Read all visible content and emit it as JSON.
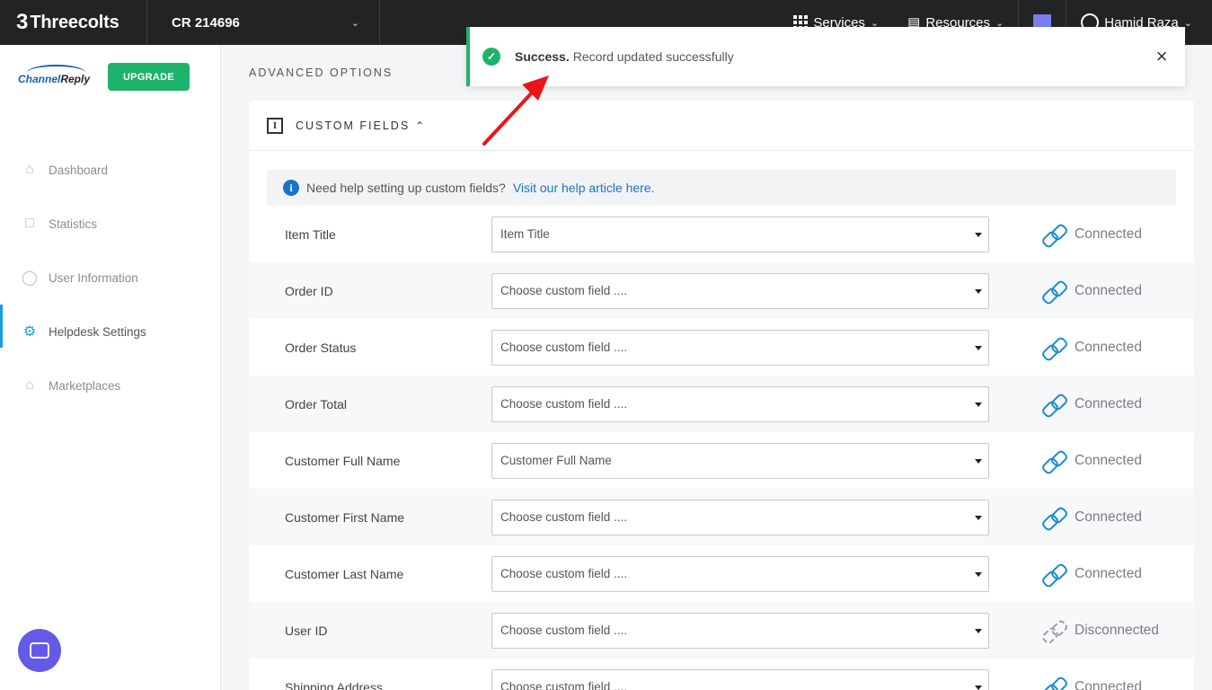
{
  "topbar": {
    "brand_mark": "3",
    "brand_name": "Threecolts",
    "account": "CR 214696",
    "services": "Services",
    "resources": "Resources",
    "user": "Hamid Raza"
  },
  "sidebar": {
    "logo_text_a": "Channel",
    "logo_text_b": "Reply",
    "upgrade": "UPGRADE",
    "items": [
      {
        "label": "Dashboard",
        "icon": "home-icon"
      },
      {
        "label": "Statistics",
        "icon": "clipboard-icon"
      },
      {
        "label": "User Information",
        "icon": "user-icon"
      },
      {
        "label": "Helpdesk Settings",
        "icon": "gear-icon"
      },
      {
        "label": "Marketplaces",
        "icon": "store-icon"
      }
    ]
  },
  "main": {
    "section_title": "ADVANCED OPTIONS",
    "card_title": "CUSTOM FIELDS",
    "help_text": "Need help setting up custom fields?",
    "help_link": "Visit our help article here.",
    "rows": [
      {
        "label": "Item Title",
        "value": "Item Title",
        "status": "Connected"
      },
      {
        "label": "Order ID",
        "value": "Choose custom field ....",
        "status": "Connected"
      },
      {
        "label": "Order Status",
        "value": "Choose custom field ....",
        "status": "Connected"
      },
      {
        "label": "Order Total",
        "value": "Choose custom field ....",
        "status": "Connected"
      },
      {
        "label": "Customer Full Name",
        "value": "Customer Full Name",
        "status": "Connected"
      },
      {
        "label": "Customer First Name",
        "value": "Choose custom field ....",
        "status": "Connected"
      },
      {
        "label": "Customer Last Name",
        "value": "Choose custom field ....",
        "status": "Connected"
      },
      {
        "label": "User ID",
        "value": "Choose custom field ....",
        "status": "Disconnected"
      },
      {
        "label": "Shipping Address",
        "value": "Choose custom field ....",
        "status": "Connected"
      }
    ]
  },
  "toast": {
    "title": "Success.",
    "message": "Record updated successfully",
    "close": "×"
  },
  "colors": {
    "accent": "#1aa0d8",
    "success": "#1eb36b",
    "link": "#1a73c8",
    "annotation": "#e8151b"
  }
}
